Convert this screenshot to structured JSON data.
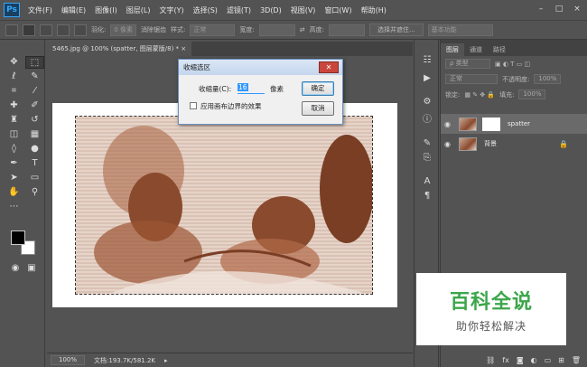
{
  "menubar": {
    "logo": "Ps",
    "items": [
      "文件(F)",
      "编辑(E)",
      "图像(I)",
      "图层(L)",
      "文字(Y)",
      "选择(S)",
      "滤镜(T)",
      "3D(D)",
      "视图(V)",
      "窗口(W)",
      "帮助(H)"
    ],
    "window_buttons": [
      "–",
      "□",
      "×"
    ]
  },
  "options": {
    "feather_label": "羽化:",
    "feather_value": "0 像素",
    "antialias_label": "消除锯齿",
    "style_label": "样式:",
    "style_value": "正常",
    "width_label": "宽度:",
    "height_label": "高度:",
    "select_mask_label": "选择并遮住...",
    "workspace_value": "基本功能"
  },
  "document": {
    "tab_title": "5465.jpg @ 100% (spatter, 图层蒙版/8) *",
    "close": "×"
  },
  "status": {
    "zoom": "100%",
    "doc_info": "文档:193.7K/581.2K"
  },
  "dialog": {
    "title": "收缩选区",
    "close": "✕",
    "amount_label": "收缩量(C):",
    "amount_value": "16",
    "unit": "像素",
    "checkbox_label": "应用画布边界的效果",
    "ok_label": "确定",
    "cancel_label": "取消"
  },
  "layers_panel": {
    "tabs": [
      "图层",
      "通道",
      "路径"
    ],
    "filter_value": "ρ 类型",
    "blend_mode": "正常",
    "opacity_label": "不透明度:",
    "opacity_value": "100%",
    "lock_label": "锁定:",
    "fill_label": "填充:",
    "fill_value": "100%",
    "layers": [
      {
        "name": "spatter",
        "selected": true
      },
      {
        "name": "背景",
        "selected": false
      }
    ]
  },
  "watermark": {
    "title": "百科全说",
    "subtitle": "助你轻松解决"
  },
  "colors": {
    "accent": "#31a8ff",
    "photo_tint": "#8a4a2e",
    "watermark_green": "#3ca64a"
  }
}
